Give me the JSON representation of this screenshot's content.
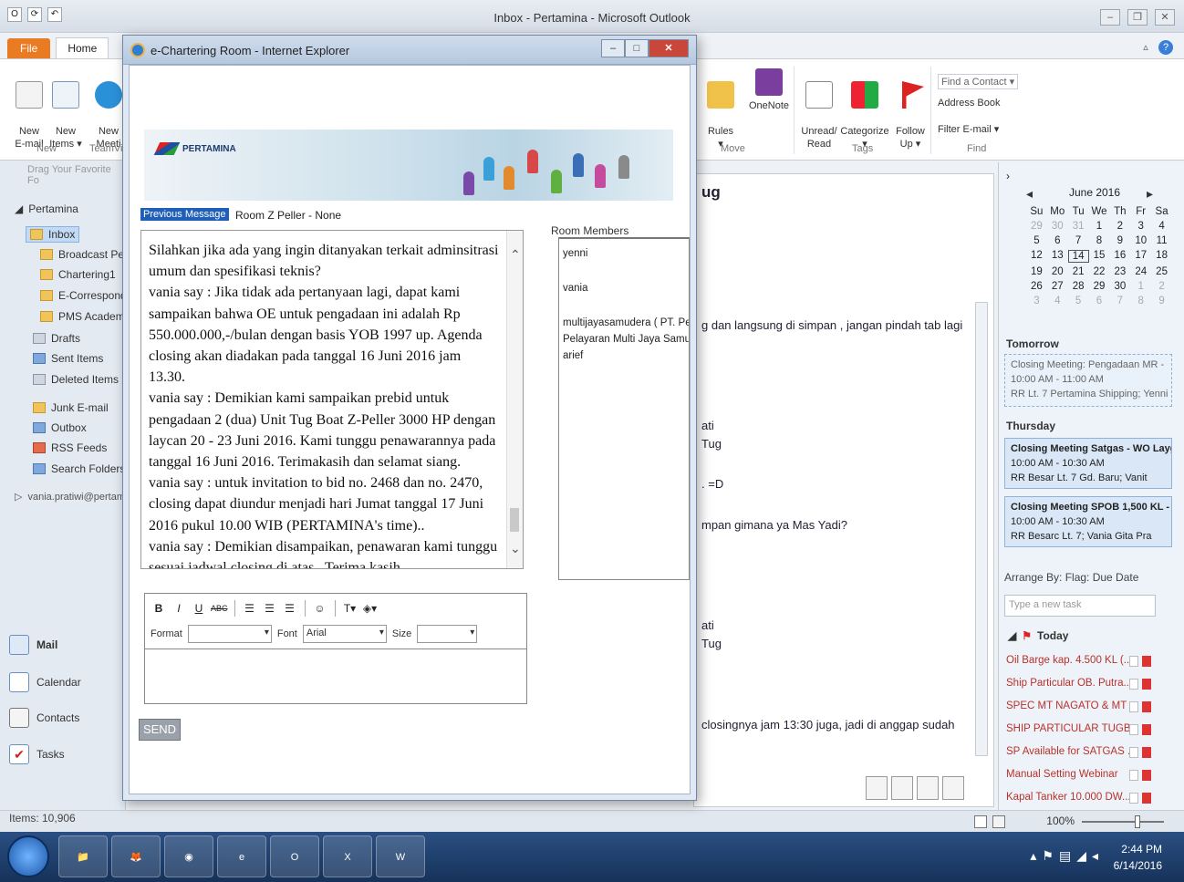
{
  "outlook": {
    "window_title": "Inbox - Pertamina - Microsoft Outlook",
    "tabs": {
      "file": "File",
      "home": "Home"
    },
    "ribbon": {
      "new_email": "New\nE-mail",
      "new_items": "New\nItems ▾",
      "new_meeting": "New\nMeeti",
      "group_new": "New",
      "group_team": "TeamVi",
      "rules": "Rules\n▾",
      "onenote": "OneNote",
      "group_move": "Move",
      "unread_read": "Unread/\nRead",
      "categorize": "Categorize\n▾",
      "follow_up": "Follow\nUp ▾",
      "group_tags": "Tags",
      "find_contact": "Find a Contact ▾",
      "address_book": "Address Book",
      "filter_email": "Filter E-mail ▾",
      "group_find": "Find"
    },
    "nav": {
      "drag_fav": "Drag Your Favorite Fo",
      "account": "Pertamina",
      "inbox": "Inbox",
      "folders": [
        "Broadcast Pert",
        "Chartering1",
        "E-Corresponde",
        "PMS Academy"
      ],
      "drafts": "Drafts",
      "sent": "Sent Items",
      "deleted": "Deleted Items",
      "junk": "Junk E-mail",
      "outbox": "Outbox",
      "rss": "RSS Feeds",
      "search": "Search Folders",
      "account2": "vania.pratiwi@pertam",
      "bottom": {
        "mail": "Mail",
        "calendar": "Calendar",
        "contacts": "Contacts",
        "tasks": "Tasks"
      }
    },
    "reading": {
      "title_fragment": "ug",
      "lines": [
        "g dan langsung di simpan , jangan pindah tab lagi",
        "ati",
        "Tug",
        ". =D",
        "mpan gimana ya Mas Yadi?",
        "ati",
        "Tug",
        "closingnya jam 13:30 juga, jadi di anggap sudah"
      ]
    },
    "todo": {
      "month": "June 2016",
      "weekdays": [
        "Su",
        "Mo",
        "Tu",
        "We",
        "Th",
        "Fr",
        "Sa"
      ],
      "days": [
        [
          "29",
          "30",
          "31",
          "1",
          "2",
          "3",
          "4"
        ],
        [
          "5",
          "6",
          "7",
          "8",
          "9",
          "10",
          "11"
        ],
        [
          "12",
          "13",
          "14",
          "15",
          "16",
          "17",
          "18"
        ],
        [
          "19",
          "20",
          "21",
          "22",
          "23",
          "24",
          "25"
        ],
        [
          "26",
          "27",
          "28",
          "29",
          "30",
          "1",
          "2"
        ],
        [
          "3",
          "4",
          "5",
          "6",
          "7",
          "8",
          "9"
        ]
      ],
      "today_label": "14",
      "tomorrow": "Tomorrow",
      "appt1": {
        "title": "Closing Meeting: Pengadaan MR -",
        "time": "10:00 AM - 11:00 AM",
        "loc": "RR Lt. 7 Pertamina Shipping; Yenni"
      },
      "thursday": "Thursday",
      "appt2": {
        "title": "Closing Meeting Satgas - WO Layg",
        "time": "10:00 AM - 10:30 AM",
        "loc": "RR Besar Lt. 7 Gd. Baru; Vanit"
      },
      "appt3": {
        "title": "Closing Meeting SPOB 1,500 KL - V",
        "time": "10:00 AM - 10:30 AM",
        "loc": "RR Besarc Lt. 7; Vania Gita Pra"
      },
      "arrange": "Arrange By: Flag: Due Date",
      "new_task_placeholder": "Type a new task",
      "today_group": "Today",
      "tasks": [
        "Oil Barge kap. 4.500 KL (...",
        "Ship Particular OB. Putra...",
        "SPEC MT NAGATO & MT ...",
        "SHIP PARTICULAR TUGB...",
        "SP Available for SATGAS ...",
        "Manual Setting Webinar",
        "Kapal Tanker 10.000 DW..."
      ]
    },
    "status": {
      "items": "Items: 10,906",
      "zoom": "100%"
    }
  },
  "ie": {
    "title": "e-Chartering Room - Internet Explorer",
    "brand": "PERTAMINA",
    "previous_message": "Previous Message",
    "room_info": "Room Z Peller - None",
    "room_members_label": "Room Members",
    "chat": "Silahkan jika ada yang ingin ditanyakan terkait adminsitrasi umum dan spesifikasi teknis?\nvania say : Jika tidak ada pertanyaan lagi, dapat kami sampaikan bahwa OE untuk pengadaan ini adalah Rp 550.000.000,-/bulan dengan basis YOB 1997 up. Agenda closing akan diadakan pada tanggal 16 Juni 2016 jam 13.30.\nvania say : Demikian kami sampaikan prebid untuk pengadaan 2 (dua) Unit Tug Boat Z-Peller 3000 HP dengan laycan 20 - 23 Juni 2016. Kami tunggu penawarannya pada tanggal 16 Juni 2016. Terimakasih dan selamat siang.\nvania say : untuk invitation to bid no. 2468 dan no. 2470, closing dapat diundur menjadi hari Jumat tanggal 17 Juni 2016 pukul 10.00 WIB (PERTAMINA's time)..\nvania say : Demikian disampaikan, penawaran kami tunggu sesuai jadwal closing di atas.. Terima kasih..",
    "members": [
      "yenni",
      "vania",
      "multijayasamudera ( PT. Pe",
      "Pelayaran Multi Jaya Samu",
      "arief"
    ],
    "editor": {
      "format_label": "Format",
      "font_label": "Font",
      "font_value": "Arial",
      "size_label": "Size"
    },
    "send": "SEND"
  },
  "taskbar": {
    "time": "2:44 PM",
    "date": "6/14/2016"
  },
  "colors": {
    "file_tab": "#e97b23",
    "selection_blue": "#1f5fb8",
    "task_red": "#b8322a",
    "taskbar": "#16325a"
  }
}
